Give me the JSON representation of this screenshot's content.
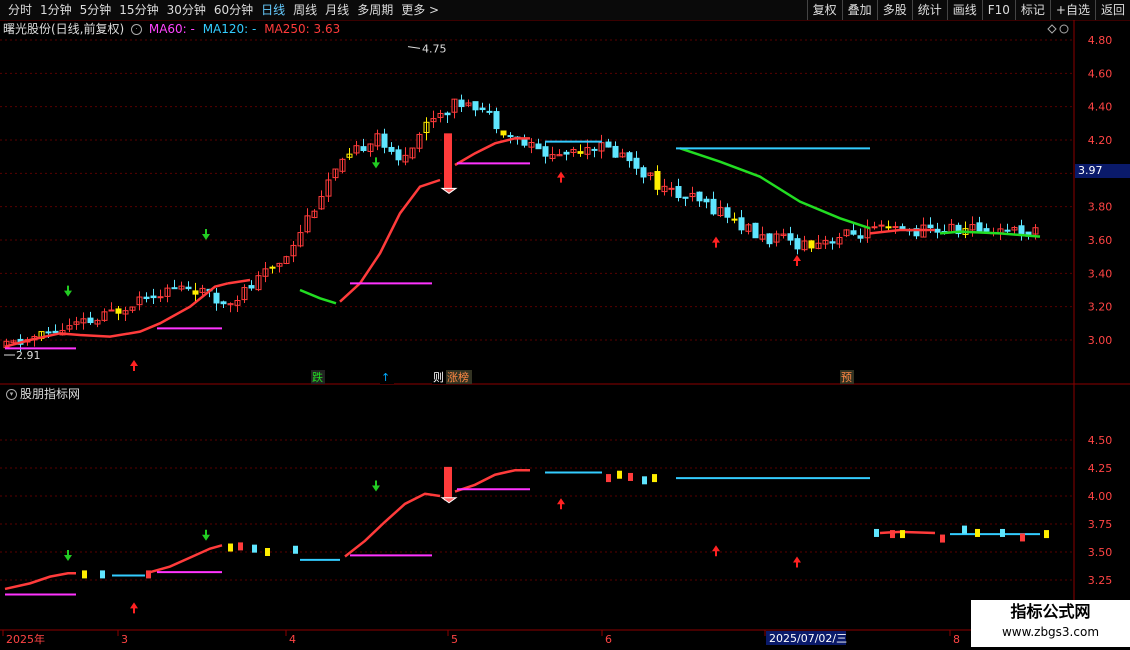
{
  "toolbar": {
    "tabs": [
      "分时",
      "1分钟",
      "5分钟",
      "15分钟",
      "30分钟",
      "60分钟",
      "日线",
      "周线",
      "月线",
      "多周期",
      "更多 >"
    ],
    "active_tab": "日线",
    "buttons": [
      "复权",
      "叠加",
      "多股",
      "统计",
      "画线",
      "F10",
      "标记",
      "+自选",
      "返回"
    ]
  },
  "main_chart": {
    "stock_name": "曙光股份(日线,前复权)",
    "ma60_label": "MA60: -",
    "ma120_label": "MA120: -",
    "ma250_label": "MA250: 3.63",
    "y_ticks": [
      "4.80",
      "4.60",
      "4.40",
      "4.20",
      "3.80",
      "3.60",
      "3.40",
      "3.20",
      "3.00"
    ],
    "current_price": "3.97",
    "high_label": "4.75",
    "low_label": "2.91",
    "markers": [
      "跌",
      "↑",
      "则",
      "涨榜",
      "预"
    ]
  },
  "sub_chart": {
    "title": "股朋指标网",
    "y_ticks": [
      "4.50",
      "4.25",
      "4.00",
      "3.75",
      "3.50",
      "3.25"
    ]
  },
  "x_axis": {
    "labels": [
      "2025年",
      "3",
      "4",
      "5",
      "6",
      "7",
      "8"
    ],
    "cursor_date": "2025/07/02/三"
  },
  "watermark": {
    "title": "指标公式网",
    "url": "www.zbgs3.com"
  },
  "colors": {
    "up": "#ff3b3b",
    "down": "#5fe6ff",
    "ma60": "#ff44ff",
    "ma120": "#33ccff",
    "ma250": "#ff3b3b",
    "green_line": "#22dd22",
    "yellow": "#ffee00",
    "magenta_line": "#ff33ff"
  }
}
